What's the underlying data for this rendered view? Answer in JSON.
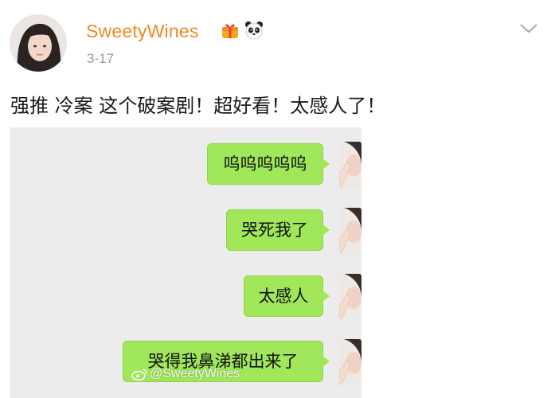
{
  "post": {
    "username": "SweetyWines",
    "date": "3-17",
    "text": "强推 冷案 这个破案剧！超好看！太感人了！",
    "badges": [
      "gift-badge-icon",
      "panda-badge-icon"
    ],
    "menu_icon": "chevron-down-icon"
  },
  "chat": {
    "messages": [
      {
        "text": "呜呜呜呜呜"
      },
      {
        "text": "哭死我了"
      },
      {
        "text": "太感人"
      },
      {
        "text": "哭得我鼻涕都出来了"
      }
    ],
    "watermark": "@SweetyWines"
  },
  "colors": {
    "username": "#f08a24",
    "date": "#9b9b9b",
    "bubble": "#a0e75a",
    "chat_background": "#ececec"
  }
}
